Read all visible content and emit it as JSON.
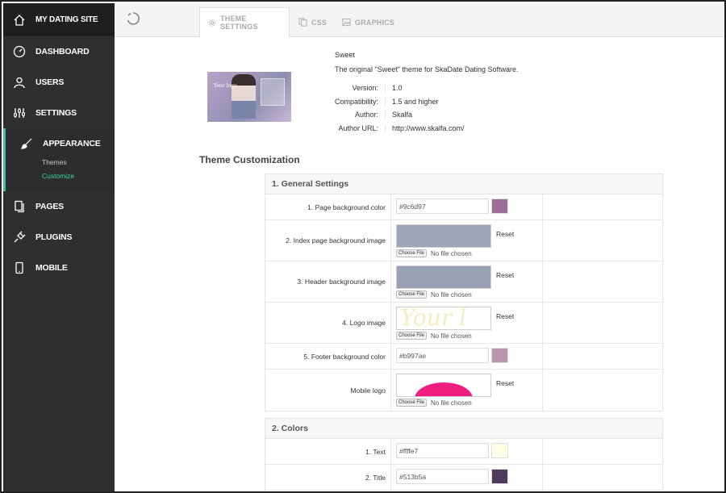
{
  "sidebar": {
    "site_title": "MY DATING SITE",
    "items": [
      {
        "label": "DASHBOARD"
      },
      {
        "label": "USERS"
      },
      {
        "label": "SETTINGS"
      },
      {
        "label": "APPEARANCE"
      },
      {
        "label": "PAGES"
      },
      {
        "label": "PLUGINS"
      },
      {
        "label": "MOBILE"
      }
    ],
    "sub_items": [
      "Themes",
      "Customize"
    ],
    "accent": "#3fd3a3"
  },
  "tabs": [
    {
      "label": "THEME SETTINGS",
      "active": true
    },
    {
      "label": "CSS"
    },
    {
      "label": "GRAPHICS"
    }
  ],
  "theme": {
    "name": "Sweet",
    "description": "The original \"Sweet\" theme for SkaDate Dating Software.",
    "preview_logo": "Your logo",
    "info": [
      {
        "key": "Version:",
        "value": "1.0"
      },
      {
        "key": "Compatibility:",
        "value": "1.5 and higher"
      },
      {
        "key": "Author:",
        "value": "Skalfa"
      },
      {
        "key": "Author URL:",
        "value": "http://www.skalfa.com/"
      }
    ]
  },
  "customization": {
    "title": "Theme Customization",
    "general": {
      "title": "1. General Settings",
      "page_bg_label": "1. Page background color",
      "page_bg_value": "#9c6d97",
      "index_bg_label": "2. Index page background image",
      "header_bg_label": "3. Header background image",
      "logo_label": "4. Logo image",
      "footer_bg_label": "5. Footer background color",
      "footer_bg_value": "#b997ae",
      "mobile_logo_label": "Mobile logo",
      "reset_label": "Reset",
      "choose_file_label": "Choose File",
      "no_file_label": "No file chosen",
      "logo_preview_text": "Your l"
    },
    "colors": {
      "title": "2. Colors",
      "text_label": "1. Text",
      "text_value": "#ffffe7",
      "title_label": "2. Title",
      "title_value": "#513b5a"
    }
  }
}
